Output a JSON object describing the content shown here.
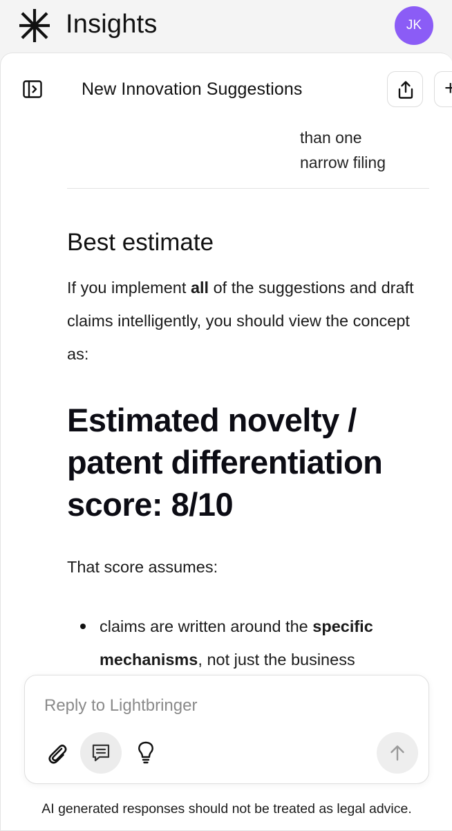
{
  "app": {
    "title": "Insights",
    "avatar_initials": "JK",
    "avatar_color": "#8b5cf6",
    "logo_icon": "asterisk-logo-icon"
  },
  "toolbar": {
    "sidebar_icon": "sidebar-toggle-icon",
    "chat_title": "New Innovation Suggestions",
    "share_icon": "share-icon",
    "new_chat_icon": "plus-icon",
    "new_chat_glyph": "+"
  },
  "message": {
    "table_tail_lines": [
      "than one",
      "narrow filing"
    ],
    "section_heading": "Best estimate",
    "intro": {
      "before_bold": "If you implement ",
      "bold": "all",
      "after_bold": " of the suggestions and draft claims intelligently, you should view the concept as:"
    },
    "score_heading": "Estimated novelty / patent differentiation score: 8/10",
    "assumes": "That score assumes:",
    "bullets": [
      {
        "before_bold": "claims are written around the ",
        "bold": "specific mechanisms",
        "after_bold": ", not just the business"
      }
    ]
  },
  "composer": {
    "placeholder": "Reply to Lightbringer",
    "attach_icon": "paperclip-icon",
    "template_icon": "message-lines-icon",
    "idea_icon": "lightbulb-icon",
    "send_icon": "arrow-up-icon"
  },
  "disclaimer": "AI generated responses should not be treated as legal advice."
}
